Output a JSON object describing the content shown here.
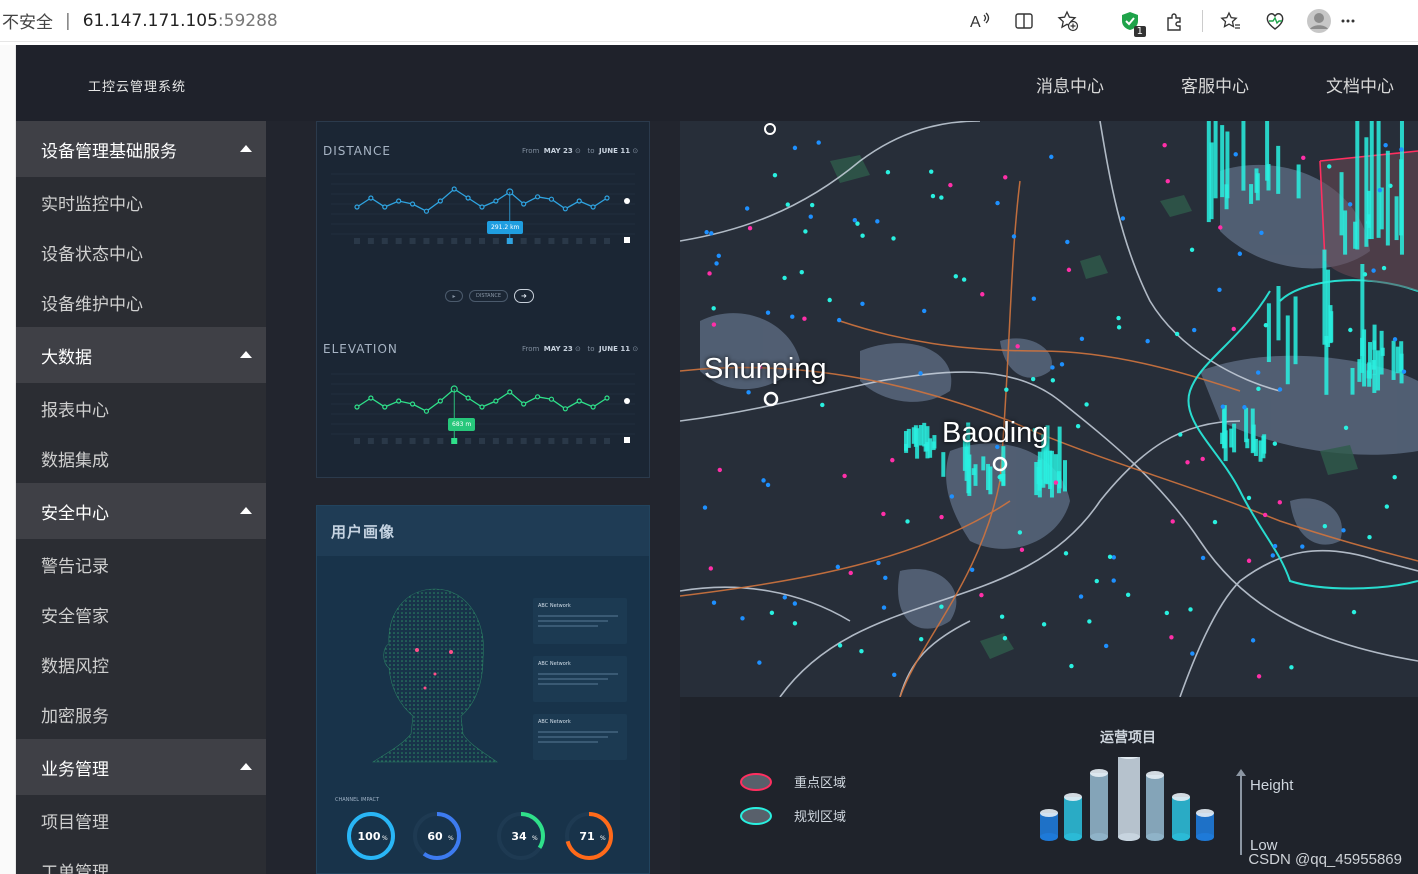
{
  "browser": {
    "security_label": "不安全",
    "address_host": "61.147.171.105",
    "address_port": ":59288",
    "extension_badge": "1"
  },
  "app": {
    "title": "工控云管理系统",
    "nav": [
      "消息中心",
      "客服中心",
      "文档中心"
    ]
  },
  "sidebar": {
    "groups": [
      {
        "label": "设备管理基础服务",
        "items": [
          "实时监控中心",
          "设备状态中心",
          "设备维护中心"
        ]
      },
      {
        "label": "大数据",
        "items": [
          "报表中心",
          "数据集成"
        ]
      },
      {
        "label": "安全中心",
        "items": [
          "警告记录",
          "安全管家",
          "数据风控",
          "加密服务"
        ]
      },
      {
        "label": "业务管理",
        "items": [
          "项目管理",
          "工单管理"
        ]
      }
    ]
  },
  "dashboard": {
    "distance": {
      "title": "DISTANCE",
      "from_label": "From",
      "from_date": "MAY 23",
      "to_label": "to",
      "to_date": "JUNE 11",
      "tooltip": "291.2 km",
      "control_label": "DISTANCE"
    },
    "elevation": {
      "title": "ELEVATION",
      "from_label": "From",
      "from_date": "MAY 23",
      "to_label": "to",
      "to_date": "JUNE 11",
      "tooltip": "683 m"
    },
    "profile": {
      "title": "用户画像",
      "cards_title": "ABC Network",
      "channel_title": "CHANNEL IMPACT",
      "rings": [
        {
          "value": "100",
          "unit": "%",
          "color": "#29b6f6",
          "fraction": 1.0
        },
        {
          "value": "60",
          "unit": "%",
          "color": "#3d7bf0",
          "fraction": 0.6
        },
        {
          "value": "34",
          "unit": "%",
          "color": "#2fe08a",
          "fraction": 0.34
        },
        {
          "value": "71",
          "unit": "%",
          "color": "#ff6a1a",
          "fraction": 0.71
        }
      ]
    },
    "map": {
      "cities": [
        "Shunping",
        "Baoding"
      ]
    },
    "legend": {
      "title": "运营项目",
      "key_area": "重点区域",
      "plan_area": "规划区域",
      "axis_high": "Height",
      "axis_low": "Low"
    }
  },
  "watermark": "CSDN @qq_45955869",
  "colors": {
    "accent_line": "#2fa3e0",
    "accent_green": "#2fe08a",
    "map_cyan": "#29f0e0",
    "map_magenta": "#ff2fa8"
  }
}
